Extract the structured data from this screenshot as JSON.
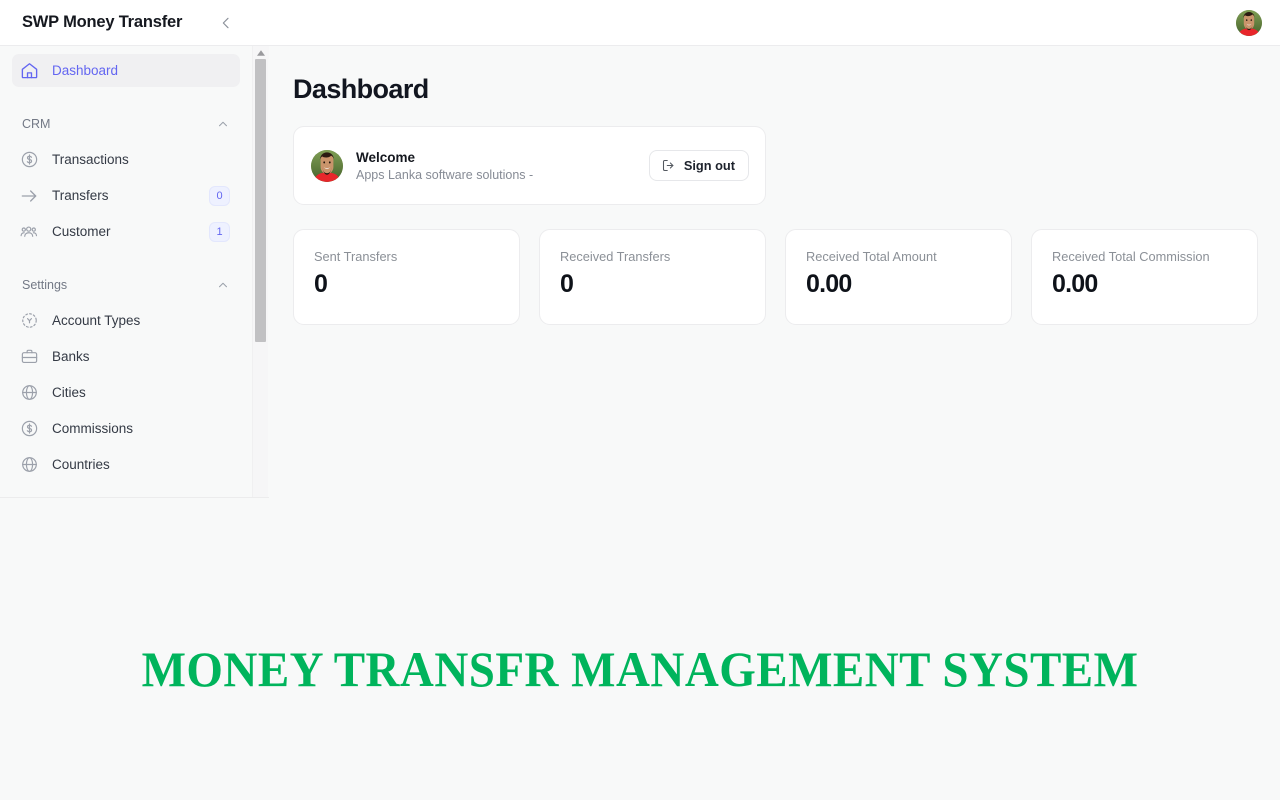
{
  "topbar": {
    "brand": "SWP Money Transfer",
    "collapse_icon": "chevron-left-icon",
    "avatar_alt": "user-avatar"
  },
  "sidebar": {
    "primary": [
      {
        "label": "Dashboard",
        "icon": "home-icon",
        "active": true,
        "badge": null
      }
    ],
    "groups": [
      {
        "title": "CRM",
        "collapse_icon": "chevron-up-icon",
        "items": [
          {
            "label": "Transactions",
            "icon": "dollar-circle-icon",
            "badge": null
          },
          {
            "label": "Transfers",
            "icon": "arrow-right-icon",
            "badge": "0"
          },
          {
            "label": "Customer",
            "icon": "users-icon",
            "badge": "1"
          }
        ]
      },
      {
        "title": "Settings",
        "collapse_icon": "chevron-up-icon",
        "items": [
          {
            "label": "Account Types",
            "icon": "dashed-circle-icon",
            "badge": null
          },
          {
            "label": "Banks",
            "icon": "briefcase-icon",
            "badge": null
          },
          {
            "label": "Cities",
            "icon": "globe-icon",
            "badge": null
          },
          {
            "label": "Commissions",
            "icon": "dollar-circle-icon",
            "badge": null
          },
          {
            "label": "Countries",
            "icon": "globe-icon",
            "badge": null
          }
        ]
      }
    ],
    "scrollbar": {
      "up_arrow_icon": "scroll-up-arrow-icon"
    }
  },
  "main": {
    "page_title": "Dashboard",
    "welcome": {
      "title": "Welcome",
      "subtitle": "Apps Lanka software solutions -",
      "avatar_alt": "user-avatar",
      "signout_label": "Sign out",
      "signout_icon": "logout-icon"
    },
    "stats": [
      {
        "label": "Sent Transfers",
        "value": "0"
      },
      {
        "label": "Received Transfers",
        "value": "0"
      },
      {
        "label": "Received Total Amount",
        "value": "0.00"
      },
      {
        "label": "Received Total Commission",
        "value": "0.00"
      }
    ]
  },
  "banner": {
    "text": "MONEY TRANSFR MANAGEMENT SYSTEM",
    "color": "#00b45c"
  },
  "colors": {
    "accent": "#6366f1",
    "badge_bg": "#eef1ff",
    "page_bg": "#f8f9f9",
    "card_bg": "#ffffff",
    "border": "#ececee",
    "banner_green": "#00b45c"
  }
}
